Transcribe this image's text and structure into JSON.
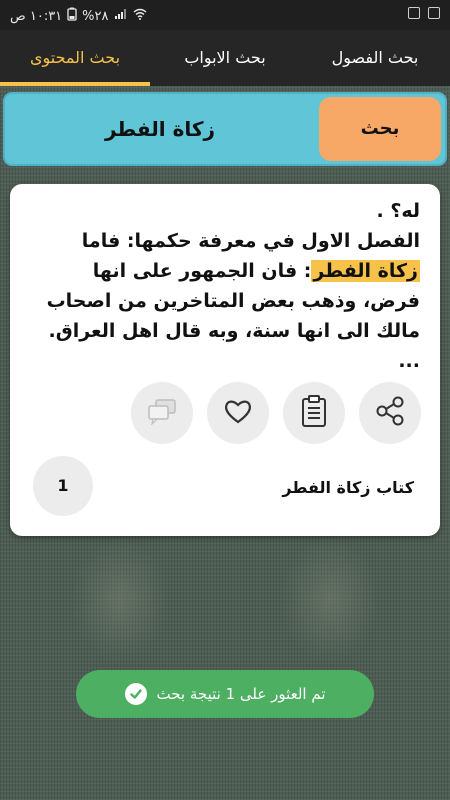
{
  "status_bar": {
    "time": "١٠:٣١ ص",
    "battery": "%٢٨",
    "icons": [
      "battery-icon",
      "signal-icon",
      "wifi-icon",
      "notification-icon",
      "image-icon"
    ]
  },
  "tabs": [
    {
      "label": "بحث الفصول"
    },
    {
      "label": "بحث الابواب"
    },
    {
      "label": "بحث المحتوى",
      "active": true
    }
  ],
  "search": {
    "button_label": "بحث",
    "query": "زكاة الفطر"
  },
  "result": {
    "text_line1": "له؟ .",
    "text_line2": "الفصل الاول في معرفة حكمها: فاما",
    "highlight": "زكاة الفطر",
    "text_after_highlight": ": فان الجمهور على انها فرض، وذهب بعض المتاخرين من اصحاب مالك الى انها سنة، وبه قال اهل العراق. ...",
    "actions": [
      "share-icon",
      "clipboard-icon",
      "heart-icon",
      "comments-icon"
    ],
    "book_title": "كتاب زكاة الفطر",
    "count": "1"
  },
  "toast": {
    "message": "تم العثور على 1 نتيجة بحث",
    "icon": "check-icon"
  },
  "colors": {
    "accent": "#f6c24a",
    "search_bar": "#5fc5d7",
    "search_button": "#f8a866",
    "toast": "#4caf62"
  }
}
